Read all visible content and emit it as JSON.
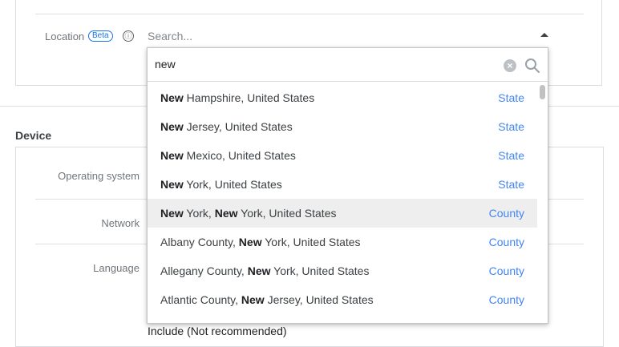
{
  "location": {
    "label": "Location",
    "beta_badge": "Beta",
    "info_icon": "ⓘ",
    "placeholder": "Search..."
  },
  "device": {
    "title": "Device",
    "operating_system_label": "Operating system",
    "network_label": "Network",
    "language_label": "Language",
    "include_text": "Include (Not recommended)"
  },
  "dropdown": {
    "query": "new",
    "clear_icon": "×",
    "results": [
      {
        "bold": "New",
        "rest": " Hampshire, United States",
        "type": "State"
      },
      {
        "bold": "New",
        "rest": " Jersey, United States",
        "type": "State"
      },
      {
        "bold": "New",
        "rest": " Mexico, United States",
        "type": "State"
      },
      {
        "bold": "New",
        "rest": " York, United States",
        "type": "State"
      },
      {
        "pre": "",
        "bold": "New",
        "mid": " York, ",
        "bold2": "New",
        "rest": " York, United States",
        "type": "County"
      },
      {
        "pre": "Albany County, ",
        "bold": "New",
        "rest": " York, United States",
        "type": "County"
      },
      {
        "pre": "Allegany County, ",
        "bold": "New",
        "rest": " York, United States",
        "type": "County"
      },
      {
        "pre": "Atlantic County, ",
        "bold": "New",
        "rest": " Jersey, United States",
        "type": "County"
      }
    ]
  },
  "colors": {
    "accent": "#4285f4",
    "highlight": "#eeeeee"
  }
}
